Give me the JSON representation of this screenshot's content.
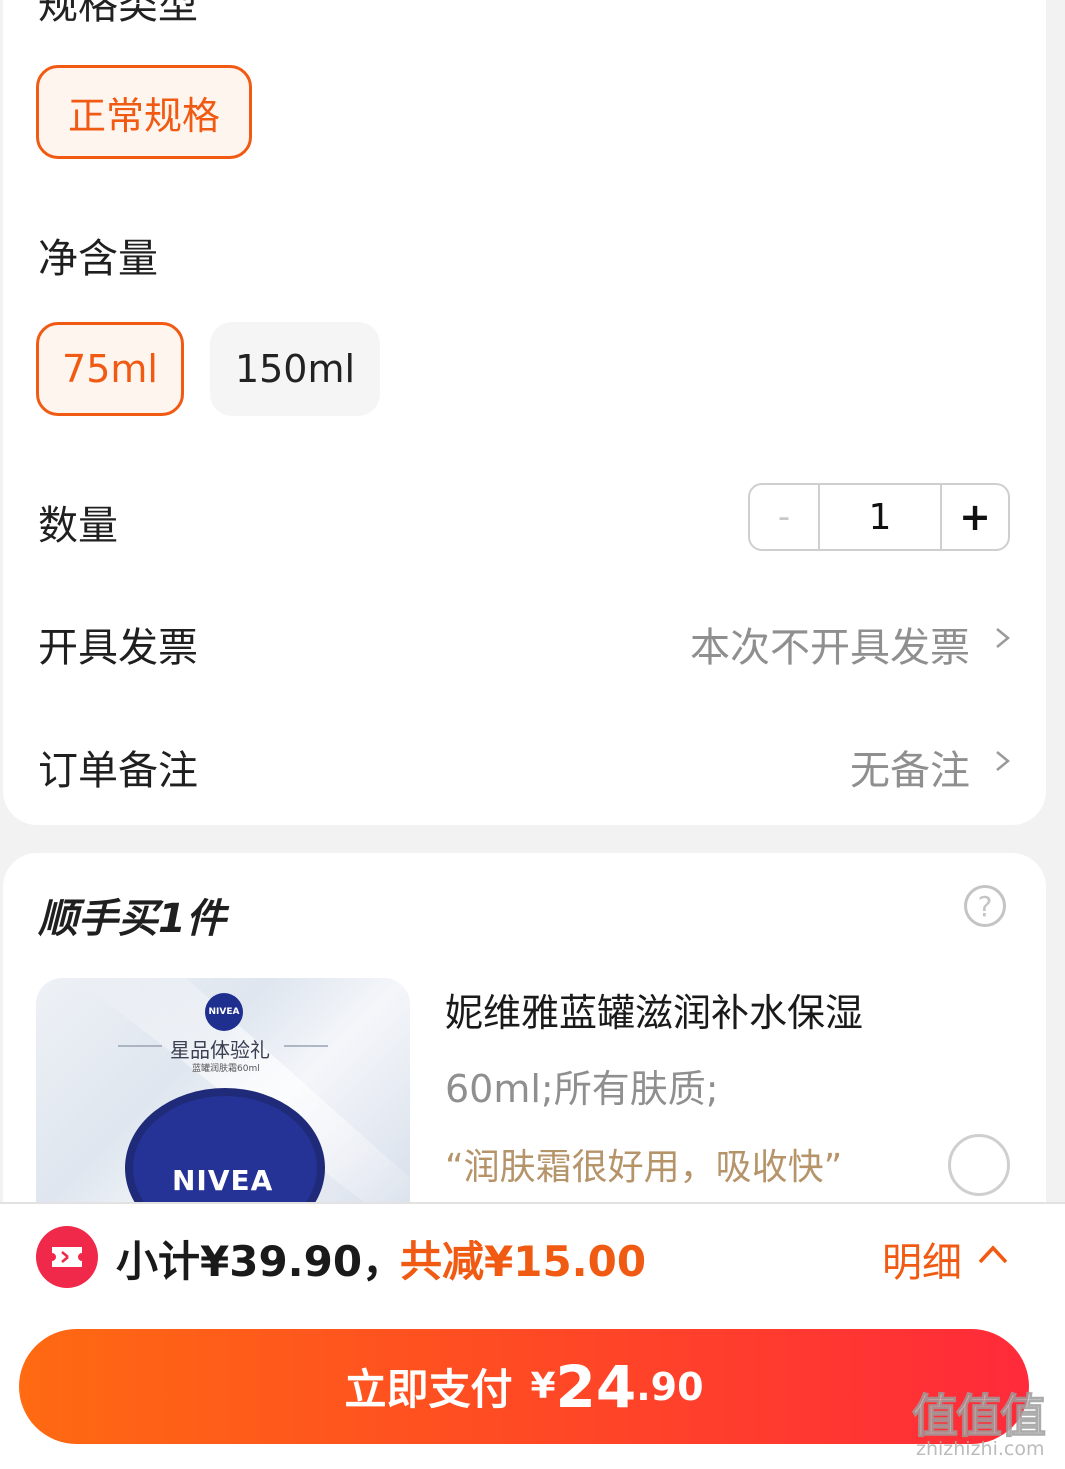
{
  "spec_section": {
    "title_partial": "规格类型",
    "type_options": [
      {
        "label": "正常规格",
        "selected": true
      }
    ],
    "volume_label": "净含量",
    "volume_options": [
      {
        "label": "75ml",
        "selected": true
      },
      {
        "label": "150ml",
        "selected": false
      }
    ]
  },
  "quantity": {
    "label": "数量",
    "minus": "-",
    "value": "1",
    "plus": "+"
  },
  "invoice": {
    "label": "开具发票",
    "value": "本次不开具发票"
  },
  "remark": {
    "label": "订单备注",
    "value": "无备注"
  },
  "addon": {
    "title": "顺手买1件",
    "help_symbol": "?",
    "product": {
      "image_brand": "NIVEA",
      "image_caption": "星品体验礼",
      "image_subcaption": "蓝罐润肤霜60ml",
      "image_tin_text": "NIVEA",
      "name": "妮维雅蓝罐滋润补水保湿",
      "spec": "60ml;所有肤质;",
      "quote": "“润肤霜很好用，吸收快”",
      "selected": false
    }
  },
  "footer": {
    "subtotal": "小计¥39.90，",
    "discount": "共减¥15.00",
    "detail": "明细",
    "pay_button": {
      "label": "立即支付",
      "currency": "¥",
      "amount_int": "24",
      "amount_dec": ".90"
    }
  },
  "watermark": {
    "main": "值值值",
    "sub": "zhizhizhi.com"
  },
  "colors": {
    "accent": "#f05a12",
    "pay_gradient_start": "#ff6a12",
    "pay_gradient_end": "#ff2a3a",
    "coupon": "#f0284a",
    "quote": "#b6946a"
  }
}
